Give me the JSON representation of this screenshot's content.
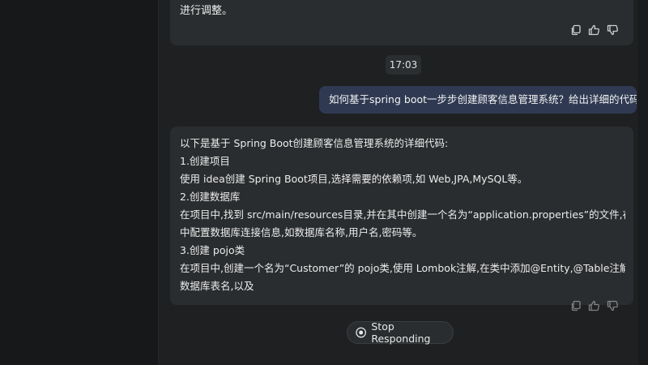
{
  "top_message": {
    "text": "进行调整。",
    "actions": [
      "copy-icon",
      "thumbs-up-icon",
      "thumbs-down-icon"
    ]
  },
  "timestamp": "17:03",
  "user_message": {
    "text": "如何基于spring boot一步步创建顾客信息管理系统？给出详细的代码"
  },
  "ai_message": {
    "lines": [
      "以下是基于 Spring Boot创建顾客信息管理系统的详细代码:",
      "1.创建项目",
      "使用 idea创建 Spring Boot项目,选择需要的依赖项,如 Web,JPA,MySQL等。",
      "2.创建数据库",
      "在项目中,找到 src/main/resources目录,并在其中创建一个名为“application.properties”的文件,在文件",
      "中配置数据库连接信息,如数据库名称,用户名,密码等。",
      "3.创建 pojo类",
      "在项目中,创建一个名为“Customer”的 pojo类,使用 Lombok注解,在类中添加@Entity,@Table注解,指定",
      "数据库表名,以及"
    ],
    "actions": [
      "copy-icon",
      "thumbs-up-icon",
      "thumbs-down-icon"
    ]
  },
  "stop_button": {
    "label": "Stop Responding",
    "icon": "stop-icon"
  },
  "colors": {
    "background": "#1e2022",
    "ai_bubble": "#2a2d2f",
    "user_bubble": "#2f3a52",
    "text": "#ececec"
  }
}
